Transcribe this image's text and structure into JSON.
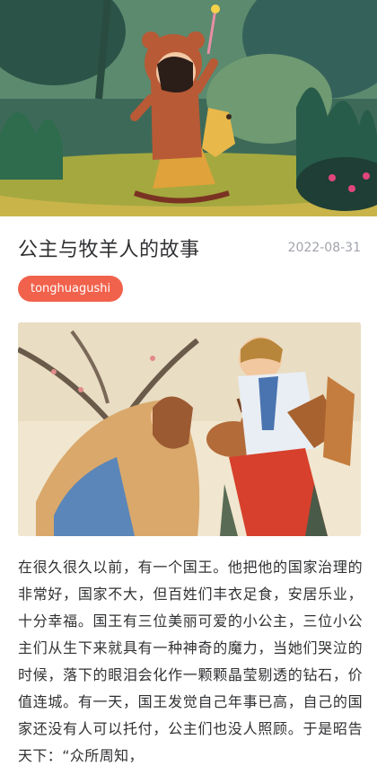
{
  "article": {
    "title": "公主与牧羊人的故事",
    "date": "2022-08-31",
    "tag": "tonghuagushi",
    "body": "在很久很久以前，有一个国王。他把他的国家治理的非常好，国家不大，但百姓们丰衣足食，安居乐业，十分幸福。国王有三位美丽可爱的小公主，三位小公主们从生下来就具有一种神奇的魔力，当她们哭泣的时候，落下的眼泪会化作一颗颗晶莹剔透的钻石，价值连城。有一天，国王发觉自己年事已高，自己的国家还没有人可以托付，公主们也没人照顾。于是昭告天下：“众所周知，"
  },
  "images": {
    "hero": "child-in-bear-costume-on-rocking-horse-illustration",
    "article": "princess-and-shepherd-with-deer-illustration"
  }
}
